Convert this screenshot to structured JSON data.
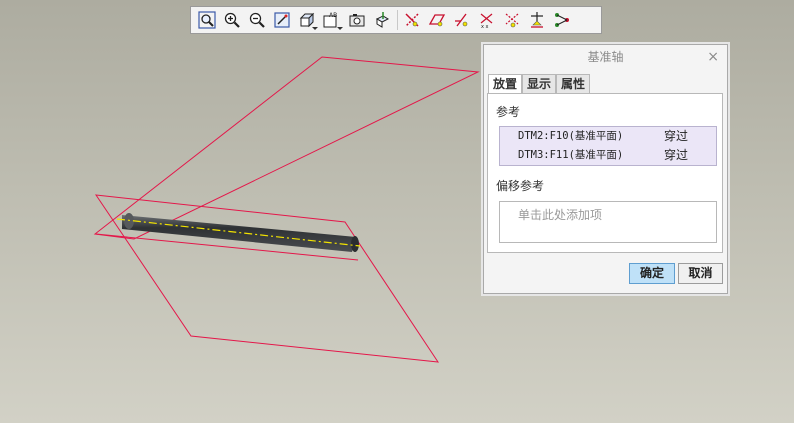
{
  "toolbar": {
    "buttons": [
      {
        "icon": "zoom-fit-icon"
      },
      {
        "icon": "zoom-in-icon"
      },
      {
        "icon": "zoom-out-icon"
      },
      {
        "icon": "repaint-icon"
      },
      {
        "icon": "view-orient-icon",
        "dropdown": true
      },
      {
        "icon": "saved-views-icon",
        "dropdown": true
      },
      {
        "icon": "camera-icon"
      },
      {
        "icon": "spin-center-icon"
      },
      {
        "icon": "datum-axis-display-icon"
      },
      {
        "icon": "datum-plane-display-icon"
      },
      {
        "icon": "datum-point-display-icon"
      },
      {
        "icon": "csys-display-icon"
      },
      {
        "icon": "point-tag-icon"
      },
      {
        "icon": "annotation-display-icon"
      },
      {
        "icon": "connection-icon"
      }
    ]
  },
  "dialog": {
    "title": "基准轴",
    "close": "×",
    "tabs": [
      "放置",
      "显示",
      "属性"
    ],
    "references_label": "参考",
    "references": [
      {
        "name": "DTM2:F10(基准平面)",
        "type": "穿过"
      },
      {
        "name": "DTM3:F11(基准平面)",
        "type": "穿过"
      }
    ],
    "offset_label": "偏移参考",
    "offset_placeholder": "单击此处添加项",
    "ok": "确定",
    "cancel": "取消"
  },
  "colors": {
    "background_top": "#adaca0",
    "background_bottom": "#d2d1c6",
    "datum_plane": "#e4174a",
    "axis_line": "#f2e300",
    "cylinder": "#3a3d40",
    "ok_button": "#bfe1f8",
    "reference_selection": "#ebe6f7"
  }
}
